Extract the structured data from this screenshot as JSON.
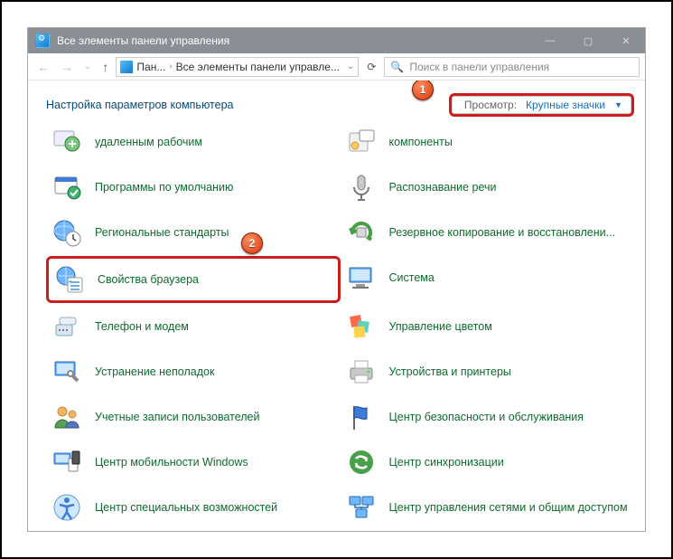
{
  "window": {
    "title": "Все элементы панели управления"
  },
  "breadcrumb": {
    "root": "Пан...",
    "current": "Все элементы панели управле..."
  },
  "search": {
    "placeholder": "Поиск в панели управления"
  },
  "heading": "Настройка параметров компьютера",
  "view": {
    "label": "Просмотр:",
    "value": "Крупные значки"
  },
  "annotations": {
    "badge1": "1",
    "badge2": "2"
  },
  "items": {
    "left": [
      "удаленным рабочим",
      "Программы по умолчанию",
      "Региональные стандарты",
      "Свойства браузера",
      "Телефон и модем",
      "Устранение неполадок",
      "Учетные записи пользователей",
      "Центр мобильности Windows",
      "Центр специальных возможностей"
    ],
    "right": [
      "компоненты",
      "Распознавание речи",
      "Резервное копирование и восстановлени...",
      "Система",
      "Управление цветом",
      "Устройства и принтеры",
      "Центр безопасности и обслуживания",
      "Центр синхронизации",
      "Центр управления сетями и общим доступом"
    ]
  }
}
